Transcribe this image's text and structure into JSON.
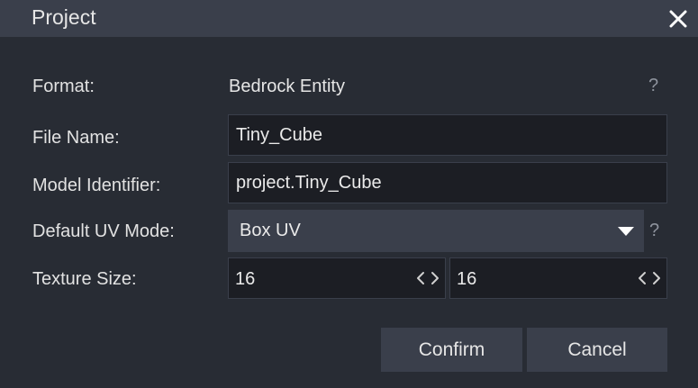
{
  "dialog": {
    "title": "Project"
  },
  "fields": {
    "format": {
      "label": "Format:",
      "value": "Bedrock Entity"
    },
    "file_name": {
      "label": "File Name:",
      "value": "Tiny_Cube"
    },
    "model_identifier": {
      "label": "Model Identifier:",
      "value": "project.Tiny_Cube"
    },
    "uv_mode": {
      "label": "Default UV Mode:",
      "selected": "Box UV"
    },
    "texture_size": {
      "label": "Texture Size:",
      "width": "16",
      "height": "16"
    },
    "help_glyph": "?"
  },
  "buttons": {
    "confirm": "Confirm",
    "cancel": "Cancel"
  },
  "icons": {
    "close": "close-icon",
    "dropdown": "caret-down-icon",
    "stepper": "horizontal-arrows-icon",
    "help": "question-mark-icon"
  },
  "colors": {
    "background": "#282c34",
    "titlebar": "#3a3f4b",
    "input_background": "#1c1e24",
    "button": "#3a3f4b",
    "text": "#e6e6e6",
    "muted": "#8e939d"
  }
}
